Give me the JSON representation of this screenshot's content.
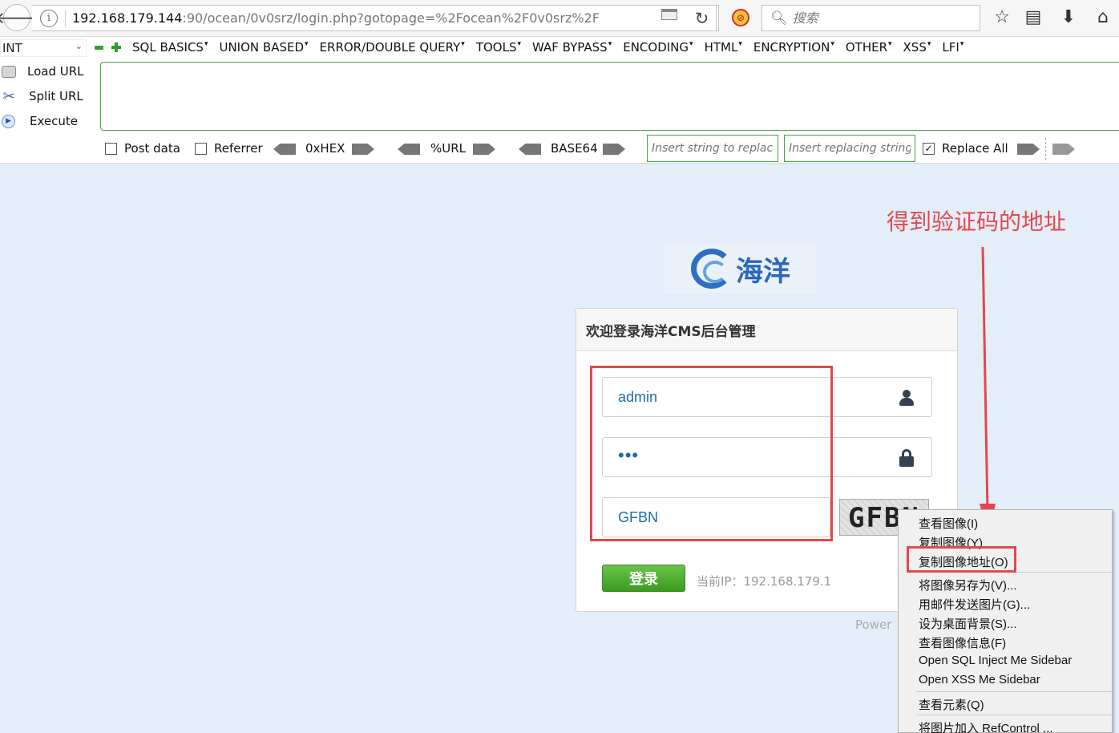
{
  "browser": {
    "url_host": "192.168.179.144",
    "url_rest": ":90/ocean/0v0srz/login.php?gotopage=%2Focean%2F0v0srz%2F",
    "search_placeholder": "搜索",
    "icons": [
      "back-arrow-icon",
      "info-icon",
      "reader-icon",
      "reload-icon",
      "block-icon",
      "search-icon",
      "star-icon",
      "library-icon",
      "download-icon",
      "home-icon"
    ]
  },
  "hackbar": {
    "type_select": "INT",
    "menu": [
      "SQL BASICS",
      "UNION BASED",
      "ERROR/DOUBLE QUERY",
      "TOOLS",
      "WAF BYPASS",
      "ENCODING",
      "HTML",
      "ENCRYPTION",
      "OTHER",
      "XSS",
      "LFI"
    ],
    "actions": {
      "load_url": "Load URL",
      "split_url": "Split URL",
      "execute": "Execute"
    },
    "options": {
      "post_data": "Post data",
      "referrer": "Referrer",
      "hex": "0xHEX",
      "url": "%URL",
      "base64": "BASE64",
      "insert_string_placeholder": "Insert string to replace",
      "insert_replacing_placeholder": "Insert replacing string",
      "replace_all": "Replace All"
    }
  },
  "page": {
    "logo_text": "海洋",
    "login_title": "欢迎登录海洋CMS后台管理",
    "username": "admin",
    "password_mask": "•••",
    "captcha_value": "GFBN",
    "captcha_image_text": "GFBN",
    "login_button": "登录",
    "ip_label": "当前IP：192.168.179.1",
    "powered": "Power"
  },
  "annotation": {
    "text": "得到验证码的地址",
    "color": "#e4474d"
  },
  "context_menu": {
    "items": [
      "查看图像(I)",
      "复制图像(Y)",
      "复制图像地址(O)",
      "将图像另存为(V)...",
      "用邮件发送图片(G)...",
      "设为桌面背景(S)...",
      "查看图像信息(F)",
      "Open SQL Inject Me Sidebar",
      "Open XSS Me Sidebar",
      "查看元素(Q)",
      "将图片加入 RefControl ..."
    ]
  }
}
